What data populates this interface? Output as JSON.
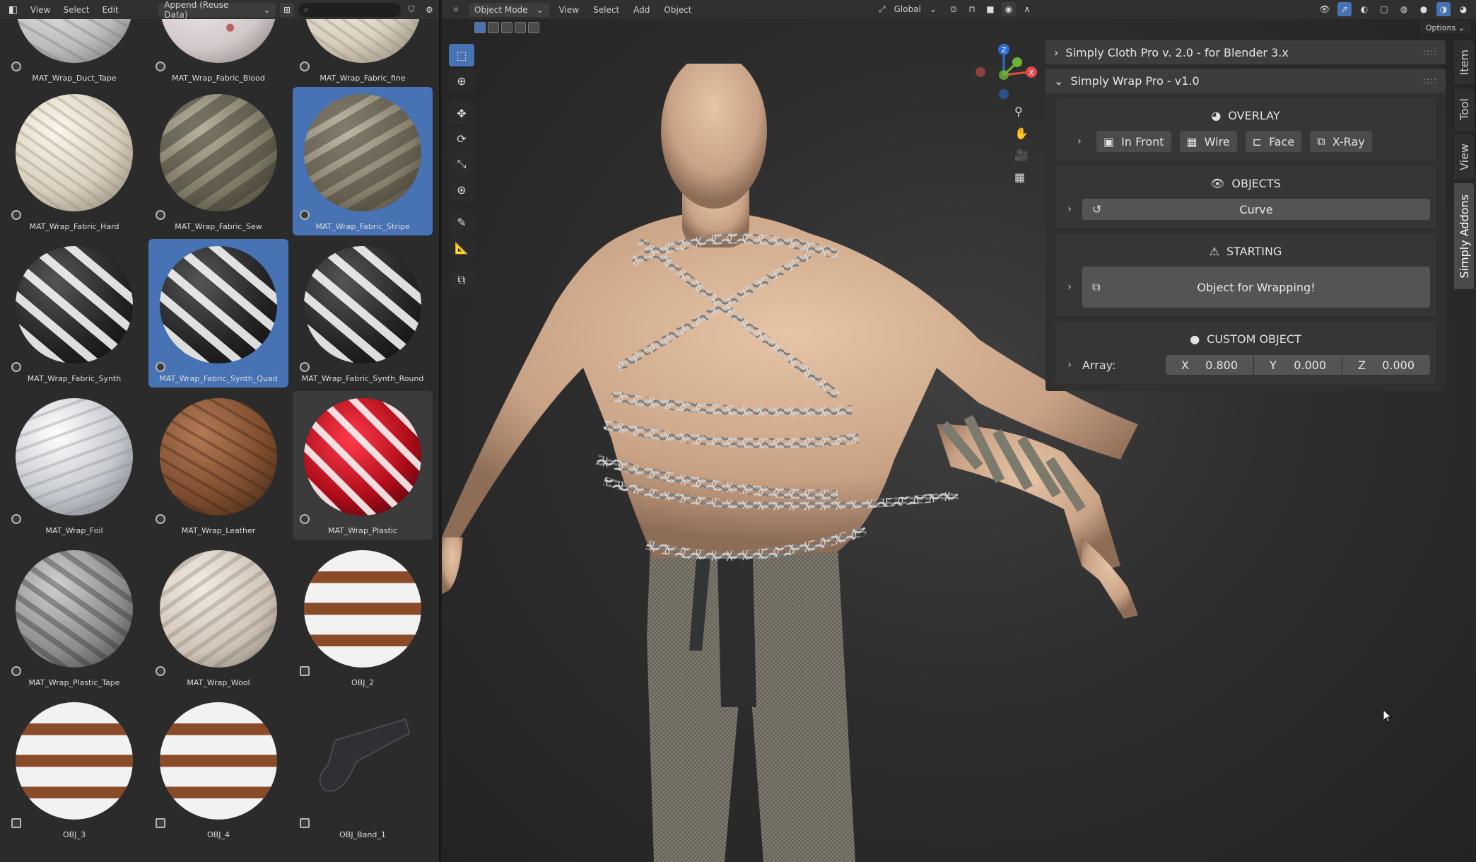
{
  "asset_browser": {
    "header": {
      "menus": [
        "View",
        "Select",
        "Edit"
      ],
      "import_method": "Append (Reuse Data)"
    },
    "assets": [
      {
        "label": "MAT_Wrap_Duct_Tape",
        "material": "duct",
        "state": "normal",
        "kind": "material"
      },
      {
        "label": "MAT_Wrap_Fabric_Blood",
        "material": "blood",
        "state": "normal",
        "kind": "material"
      },
      {
        "label": "MAT_Wrap_Fabric_fine",
        "material": "white",
        "state": "normal",
        "kind": "material"
      },
      {
        "label": "MAT_Wrap_Fabric_Hard",
        "material": "white",
        "state": "normal",
        "kind": "material"
      },
      {
        "label": "MAT_Wrap_Fabric_Sew",
        "material": "sew",
        "state": "normal",
        "kind": "material"
      },
      {
        "label": "MAT_Wrap_Fabric_Stripe",
        "material": "stripe",
        "state": "selected",
        "kind": "material"
      },
      {
        "label": "MAT_Wrap_Fabric_Synth",
        "material": "black",
        "state": "normal",
        "kind": "material"
      },
      {
        "label": "MAT_Wrap_Fabric_Synth_Quad",
        "material": "black",
        "state": "selected",
        "kind": "material"
      },
      {
        "label": "MAT_Wrap_Fabric_Synth_Round",
        "material": "black",
        "state": "normal",
        "kind": "material"
      },
      {
        "label": "MAT_Wrap_Foil",
        "material": "foil",
        "state": "normal",
        "kind": "material"
      },
      {
        "label": "MAT_Wrap_Leather",
        "material": "leather",
        "state": "normal",
        "kind": "material"
      },
      {
        "label": "MAT_Wrap_Plastic",
        "material": "plastic",
        "state": "hover",
        "kind": "material"
      },
      {
        "label": "MAT_Wrap_Plastic_Tape",
        "material": "ptape",
        "state": "normal",
        "kind": "material"
      },
      {
        "label": "MAT_Wrap_Wool",
        "material": "wool",
        "state": "normal",
        "kind": "material"
      },
      {
        "label": "OBJ_2",
        "material": "band",
        "state": "normal",
        "kind": "object"
      },
      {
        "label": "OBJ_3",
        "material": "band",
        "state": "normal",
        "kind": "object"
      },
      {
        "label": "OBJ_4",
        "material": "band",
        "state": "normal",
        "kind": "object"
      },
      {
        "label": "OBJ_Band_1",
        "material": "strap",
        "state": "normal",
        "kind": "object"
      }
    ]
  },
  "viewport": {
    "header": {
      "mode": "Object Mode",
      "menus": [
        "View",
        "Select",
        "Add",
        "Object"
      ],
      "transform_orientation": "Global"
    },
    "options_label": "Options",
    "tools": [
      "select-box",
      "cursor",
      "move",
      "rotate",
      "scale",
      "transform",
      "annotate",
      "measure",
      "add-cube"
    ],
    "gizmo_axes": {
      "x": "X",
      "y": "Y",
      "z": "Z"
    }
  },
  "npanel": {
    "collapsed_panel_title": "Simply Cloth Pro v. 2.0 - for Blender 3.x",
    "panel_title": "Simply Wrap Pro - v1.0",
    "overlay": {
      "title": "OVERLAY",
      "buttons": [
        "In Front",
        "Wire",
        "Face",
        "X-Ray"
      ]
    },
    "objects": {
      "title": "OBJECTS",
      "curve_button": "Curve"
    },
    "starting": {
      "title": "STARTING",
      "wrap_button": "Object for Wrapping!"
    },
    "custom_object": {
      "title": "CUSTOM OBJECT",
      "array_label": "Array:",
      "x_label": "X",
      "x_value": "0.800",
      "y_label": "Y",
      "y_value": "0.000",
      "z_label": "Z",
      "z_value": "0.000"
    }
  },
  "side_tabs": [
    "Item",
    "Tool",
    "View",
    "Simply Addons"
  ],
  "active_side_tab": "Simply Addons",
  "colors": {
    "accent": "#4772b3",
    "panel_bg": "#303030",
    "button_bg": "#545454"
  }
}
